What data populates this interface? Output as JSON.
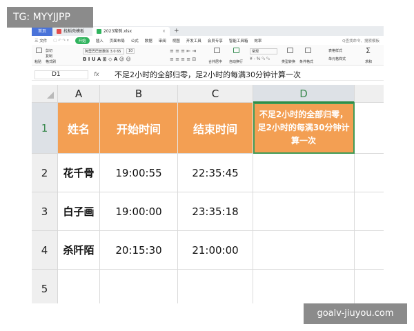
{
  "watermarks": {
    "top_left": "TG: MYYJJPP",
    "bottom_right": "goalv-jiuyou.com"
  },
  "tabs": [
    {
      "label": "首页",
      "active": false
    },
    {
      "label": "找稻壳模板",
      "active": false
    },
    {
      "label": "2023案例.xlsx",
      "active": true
    }
  ],
  "tab_new": "+",
  "menu": {
    "file": "三 文件",
    "start": "开始",
    "items": [
      "插入",
      "页面布局",
      "公式",
      "数据",
      "审阅",
      "视图",
      "开发工具",
      "会员专享",
      "智能工具箱",
      "效率"
    ],
    "search": "Q查找命令、搜索模板"
  },
  "ribbon": {
    "cut": "剪切",
    "paste": "粘贴",
    "copy": "复制",
    "format_painter": "格式刷",
    "font": "阿里巴巴普惠体 3.0 65",
    "font_size": "10",
    "merge": "合并居中",
    "wrap": "自动换行",
    "number_format": "常规",
    "convert": "类型转换",
    "cond_format": "条件格式",
    "table_style": "表格样式",
    "cell_style": "单元格样式",
    "sum": "求和"
  },
  "formula_bar": {
    "name_box": "D1",
    "fx": "fx",
    "content": "不足2小时的全部归零，足2小时的每满30分钟计算一次"
  },
  "sheet": {
    "columns": [
      "A",
      "B",
      "C",
      "D"
    ],
    "selected_column": "D",
    "rows": [
      "1",
      "2",
      "3",
      "4",
      "5"
    ],
    "header_row": [
      "姓名",
      "开始时间",
      "结束时间",
      "不足2小时的全部归零，足2小时的每满30分钟计算一次"
    ],
    "data": [
      [
        "花千骨",
        "19:00:55",
        "22:35:45",
        ""
      ],
      [
        "白子画",
        "19:00:00",
        "23:35:18",
        ""
      ],
      [
        "杀阡陌",
        "20:15:30",
        "21:00:00",
        ""
      ],
      [
        "",
        "",
        "",
        ""
      ]
    ],
    "header_fill": "#f39f53",
    "selection_color": "#3f9a55"
  }
}
